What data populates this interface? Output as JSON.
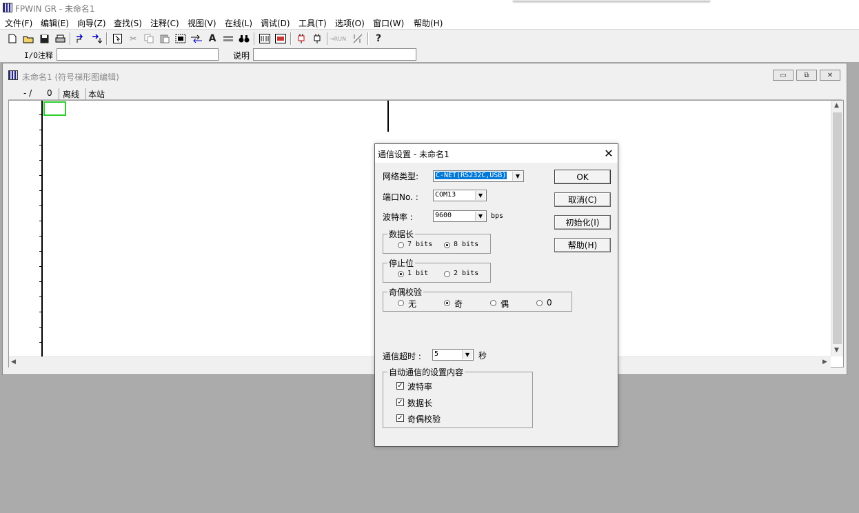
{
  "app": {
    "title": "FPWIN GR - 未命名1"
  },
  "menu": [
    "文件(F)",
    "编辑(E)",
    "向导(Z)",
    "查找(S)",
    "注释(C)",
    "视图(V)",
    "在线(L)",
    "调试(D)",
    "工具(T)",
    "选项(O)",
    "窗口(W)",
    "帮助(H)"
  ],
  "toolbar_icons": [
    "new-file-icon",
    "open-folder-icon",
    "save-icon",
    "print-icon",
    "compile-icon",
    "convert-icon",
    "select-icon",
    "cut-icon",
    "copy-icon",
    "paste-icon",
    "block-icon",
    "move-icon",
    "text-icon",
    "line-icon",
    "binoculars-icon",
    "monitor-icon",
    "program-icon",
    "plug-icon",
    "upload-icon",
    "run-icon",
    "mode-icon",
    "help-icon"
  ],
  "toolbar_text": {
    "text_button": "A",
    "run_button": "→RUN",
    "help_button": "?"
  },
  "io_bar": {
    "io_label": "I/O注释",
    "io_value": "",
    "desc_label": "说明",
    "desc_value": ""
  },
  "child": {
    "title": "未命名1 (符号梯形图编辑)",
    "status": {
      "address": "- /",
      "step": "0",
      "mode": "离线",
      "station": "本站"
    },
    "buttons": {
      "minimize": "▭",
      "restore": "⧉",
      "close": "✕"
    }
  },
  "dialog": {
    "title": "通信设置 - 未命名1",
    "close": "✕",
    "network_label": "网络类型:",
    "network_value": "C-NET(RS232C,USB)",
    "port_label": "端口No. :",
    "port_value": "COM13",
    "baud_label": "波特率  :",
    "baud_value": "9600",
    "baud_unit": "bps",
    "data_length": {
      "title": "数据长",
      "options": [
        "7 bits",
        "8 bits"
      ],
      "selected": 1
    },
    "stop_bit": {
      "title": "停止位",
      "options": [
        "1 bit",
        "2 bits"
      ],
      "selected": 0
    },
    "parity": {
      "title": "奇偶校验",
      "options": [
        "无",
        "奇",
        "偶",
        "0"
      ],
      "selected": 1
    },
    "timeout_label": "通信超时 :",
    "timeout_value": "5",
    "timeout_unit": "秒",
    "auto": {
      "title": "自动通信的设置内容",
      "items": [
        {
          "label": "波特率",
          "checked": true
        },
        {
          "label": "数据长",
          "checked": true
        },
        {
          "label": "奇偶校验",
          "checked": true
        }
      ]
    },
    "buttons": {
      "ok": "OK",
      "cancel": "取消(C)",
      "init": "初始化(I)",
      "help": "帮助(H)"
    }
  }
}
